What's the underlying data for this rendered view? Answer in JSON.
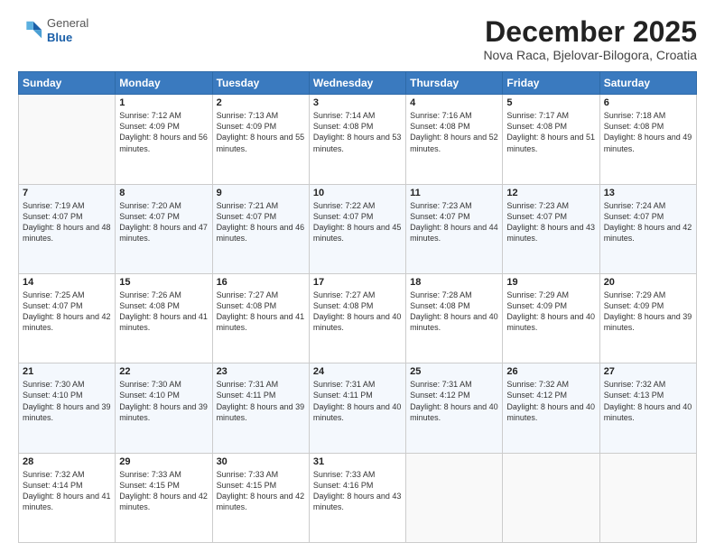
{
  "logo": {
    "general": "General",
    "blue": "Blue"
  },
  "header": {
    "month": "December 2025",
    "location": "Nova Raca, Bjelovar-Bilogora, Croatia"
  },
  "weekdays": [
    "Sunday",
    "Monday",
    "Tuesday",
    "Wednesday",
    "Thursday",
    "Friday",
    "Saturday"
  ],
  "weeks": [
    [
      {
        "day": "",
        "info": ""
      },
      {
        "day": "1",
        "info": "Sunrise: 7:12 AM\nSunset: 4:09 PM\nDaylight: 8 hours\nand 56 minutes."
      },
      {
        "day": "2",
        "info": "Sunrise: 7:13 AM\nSunset: 4:09 PM\nDaylight: 8 hours\nand 55 minutes."
      },
      {
        "day": "3",
        "info": "Sunrise: 7:14 AM\nSunset: 4:08 PM\nDaylight: 8 hours\nand 53 minutes."
      },
      {
        "day": "4",
        "info": "Sunrise: 7:16 AM\nSunset: 4:08 PM\nDaylight: 8 hours\nand 52 minutes."
      },
      {
        "day": "5",
        "info": "Sunrise: 7:17 AM\nSunset: 4:08 PM\nDaylight: 8 hours\nand 51 minutes."
      },
      {
        "day": "6",
        "info": "Sunrise: 7:18 AM\nSunset: 4:08 PM\nDaylight: 8 hours\nand 49 minutes."
      }
    ],
    [
      {
        "day": "7",
        "info": "Sunrise: 7:19 AM\nSunset: 4:07 PM\nDaylight: 8 hours\nand 48 minutes."
      },
      {
        "day": "8",
        "info": "Sunrise: 7:20 AM\nSunset: 4:07 PM\nDaylight: 8 hours\nand 47 minutes."
      },
      {
        "day": "9",
        "info": "Sunrise: 7:21 AM\nSunset: 4:07 PM\nDaylight: 8 hours\nand 46 minutes."
      },
      {
        "day": "10",
        "info": "Sunrise: 7:22 AM\nSunset: 4:07 PM\nDaylight: 8 hours\nand 45 minutes."
      },
      {
        "day": "11",
        "info": "Sunrise: 7:23 AM\nSunset: 4:07 PM\nDaylight: 8 hours\nand 44 minutes."
      },
      {
        "day": "12",
        "info": "Sunrise: 7:23 AM\nSunset: 4:07 PM\nDaylight: 8 hours\nand 43 minutes."
      },
      {
        "day": "13",
        "info": "Sunrise: 7:24 AM\nSunset: 4:07 PM\nDaylight: 8 hours\nand 42 minutes."
      }
    ],
    [
      {
        "day": "14",
        "info": "Sunrise: 7:25 AM\nSunset: 4:07 PM\nDaylight: 8 hours\nand 42 minutes."
      },
      {
        "day": "15",
        "info": "Sunrise: 7:26 AM\nSunset: 4:08 PM\nDaylight: 8 hours\nand 41 minutes."
      },
      {
        "day": "16",
        "info": "Sunrise: 7:27 AM\nSunset: 4:08 PM\nDaylight: 8 hours\nand 41 minutes."
      },
      {
        "day": "17",
        "info": "Sunrise: 7:27 AM\nSunset: 4:08 PM\nDaylight: 8 hours\nand 40 minutes."
      },
      {
        "day": "18",
        "info": "Sunrise: 7:28 AM\nSunset: 4:08 PM\nDaylight: 8 hours\nand 40 minutes."
      },
      {
        "day": "19",
        "info": "Sunrise: 7:29 AM\nSunset: 4:09 PM\nDaylight: 8 hours\nand 40 minutes."
      },
      {
        "day": "20",
        "info": "Sunrise: 7:29 AM\nSunset: 4:09 PM\nDaylight: 8 hours\nand 39 minutes."
      }
    ],
    [
      {
        "day": "21",
        "info": "Sunrise: 7:30 AM\nSunset: 4:10 PM\nDaylight: 8 hours\nand 39 minutes."
      },
      {
        "day": "22",
        "info": "Sunrise: 7:30 AM\nSunset: 4:10 PM\nDaylight: 8 hours\nand 39 minutes."
      },
      {
        "day": "23",
        "info": "Sunrise: 7:31 AM\nSunset: 4:11 PM\nDaylight: 8 hours\nand 39 minutes."
      },
      {
        "day": "24",
        "info": "Sunrise: 7:31 AM\nSunset: 4:11 PM\nDaylight: 8 hours\nand 40 minutes."
      },
      {
        "day": "25",
        "info": "Sunrise: 7:31 AM\nSunset: 4:12 PM\nDaylight: 8 hours\nand 40 minutes."
      },
      {
        "day": "26",
        "info": "Sunrise: 7:32 AM\nSunset: 4:12 PM\nDaylight: 8 hours\nand 40 minutes."
      },
      {
        "day": "27",
        "info": "Sunrise: 7:32 AM\nSunset: 4:13 PM\nDaylight: 8 hours\nand 40 minutes."
      }
    ],
    [
      {
        "day": "28",
        "info": "Sunrise: 7:32 AM\nSunset: 4:14 PM\nDaylight: 8 hours\nand 41 minutes."
      },
      {
        "day": "29",
        "info": "Sunrise: 7:33 AM\nSunset: 4:15 PM\nDaylight: 8 hours\nand 42 minutes."
      },
      {
        "day": "30",
        "info": "Sunrise: 7:33 AM\nSunset: 4:15 PM\nDaylight: 8 hours\nand 42 minutes."
      },
      {
        "day": "31",
        "info": "Sunrise: 7:33 AM\nSunset: 4:16 PM\nDaylight: 8 hours\nand 43 minutes."
      },
      {
        "day": "",
        "info": ""
      },
      {
        "day": "",
        "info": ""
      },
      {
        "day": "",
        "info": ""
      }
    ]
  ]
}
